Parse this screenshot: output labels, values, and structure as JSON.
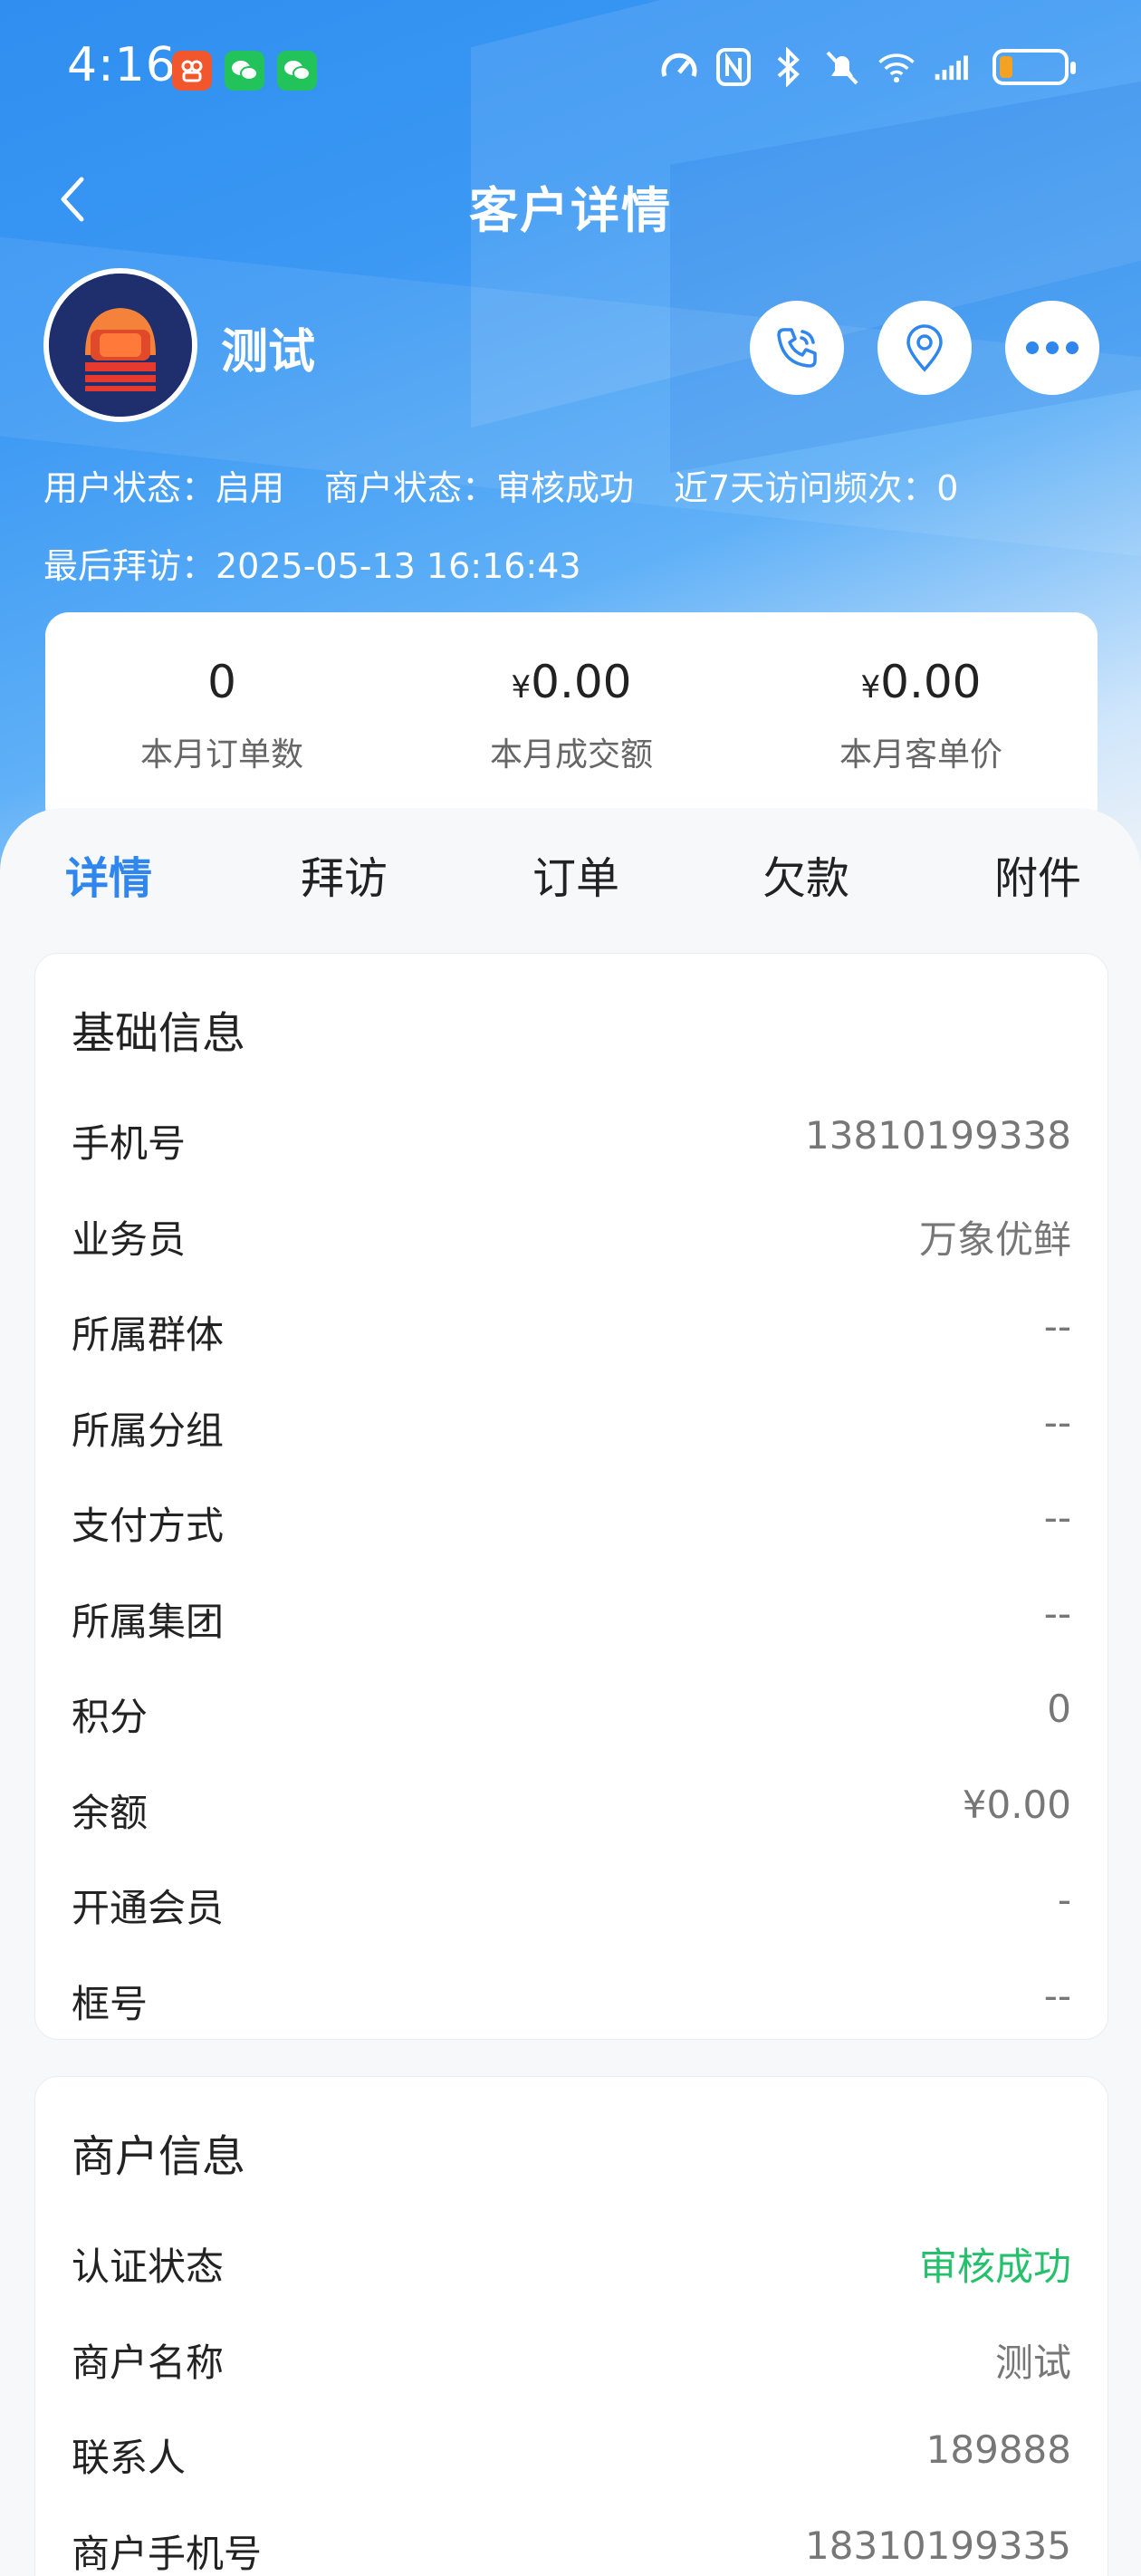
{
  "status_bar": {
    "time": "4:16",
    "battery_level": 0.2
  },
  "nav": {
    "title": "客户详情"
  },
  "profile": {
    "name": "测试",
    "user_status": "用户状态：启用",
    "merchant_status": "商户状态：审核成功",
    "visit_frequency": "近7天访问频次：0",
    "last_visit": "最后拜访：2025-05-13 16:16:43"
  },
  "stats": [
    {
      "currency": "",
      "value": "0",
      "label": "本月订单数"
    },
    {
      "currency": "¥",
      "value": "0.00",
      "label": "本月成交额"
    },
    {
      "currency": "¥",
      "value": "0.00",
      "label": "本月客单价"
    }
  ],
  "tabs": [
    "详情",
    "拜访",
    "订单",
    "欠款",
    "附件"
  ],
  "active_tab": "详情",
  "basic_info": {
    "title": "基础信息",
    "rows": [
      {
        "label": "手机号",
        "value": "13810199338"
      },
      {
        "label": "业务员",
        "value": "万象优鲜"
      },
      {
        "label": "所属群体",
        "value": "--"
      },
      {
        "label": "所属分组",
        "value": "--"
      },
      {
        "label": "支付方式",
        "value": "--"
      },
      {
        "label": "所属集团",
        "value": "--"
      },
      {
        "label": "积分",
        "value": "0"
      },
      {
        "label": "余额",
        "value": "¥0.00"
      },
      {
        "label": "开通会员",
        "value": "-"
      },
      {
        "label": "框号",
        "value": "--"
      }
    ]
  },
  "merchant_info": {
    "title": "商户信息",
    "rows": [
      {
        "label": "认证状态",
        "value": "审核成功",
        "color": "#24c06b"
      },
      {
        "label": "商户名称",
        "value": "测试"
      },
      {
        "label": "联系人",
        "value": "189888"
      },
      {
        "label": "商户手机号",
        "value": "18310199335"
      }
    ]
  },
  "colors": {
    "accent": "#2f86ee",
    "success": "#24c06b",
    "header": "#2f8ef0"
  }
}
